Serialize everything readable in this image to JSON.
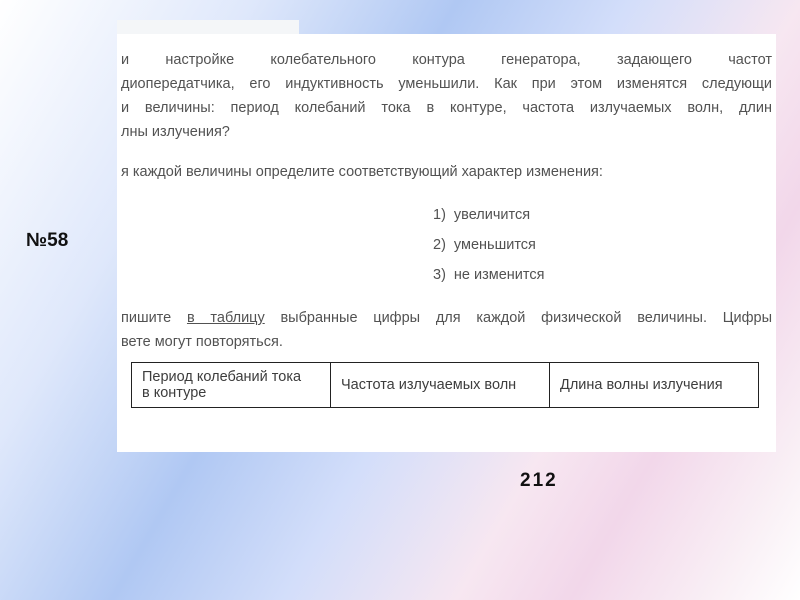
{
  "problem_number": "№58",
  "body": {
    "paragraph1_lines": [
      "и настройке колебательного контура генератора, задающего частот",
      "диопередатчика, его индуктивность уменьшили. Как при этом изменятся следующи",
      "и величины: период колебаний тока в контуре, частота излучаемых волн, длин",
      "лны излучения?"
    ],
    "instruction1": "я каждой величины определите соответствующий характер изменения:",
    "options": [
      {
        "n": "1)",
        "text": "увеличится"
      },
      {
        "n": "2)",
        "text": "уменьшится"
      },
      {
        "n": "3)",
        "text": "не изменится"
      }
    ],
    "instruction2_pre": "пишите ",
    "instruction2_link": "в таблицу",
    "instruction2_post": " выбранные цифры для каждой физической величины. Цифры ",
    "instruction2_line2": "вете могут повторяться.",
    "table": {
      "c1_l1": "Период колебаний тока",
      "c1_l2": "в контуре",
      "c2": "Частота излучаемых волн",
      "c3": "Длина волны излучения"
    }
  },
  "answer": "212"
}
